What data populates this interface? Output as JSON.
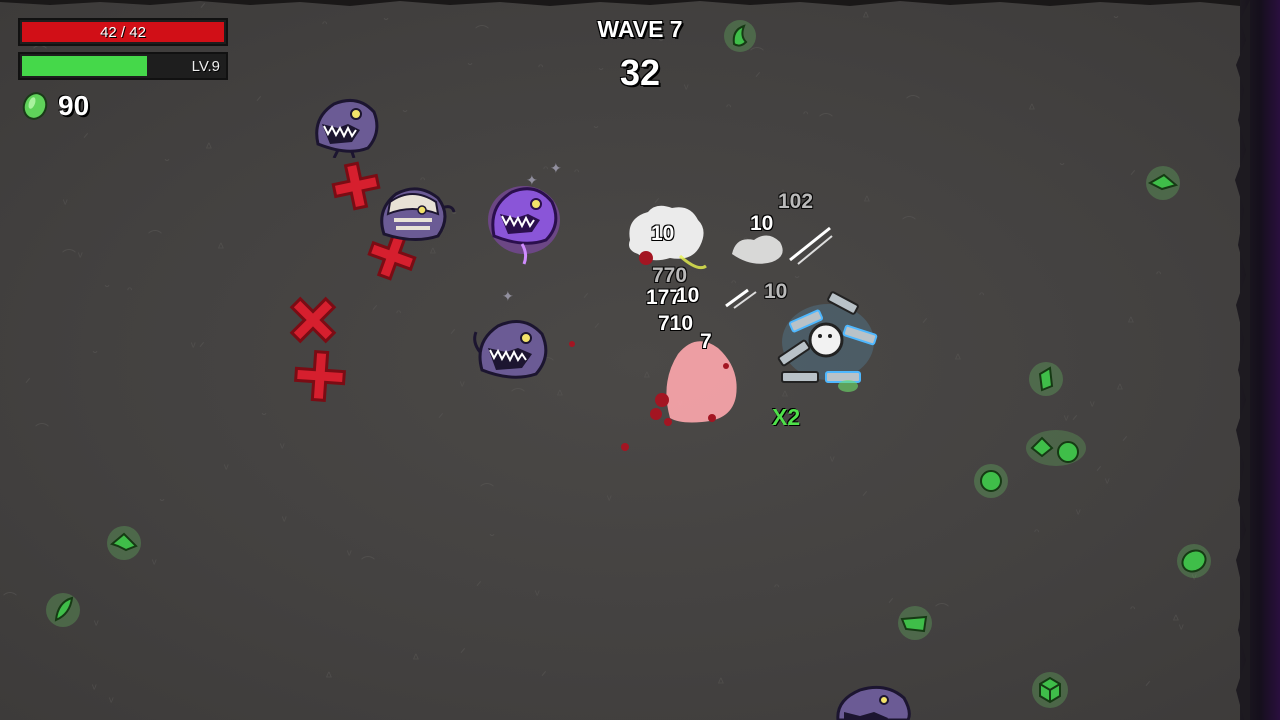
{
  "hud": {
    "hp": {
      "current": 42,
      "max": 42,
      "label": "42 / 42",
      "fraction": 1.0,
      "color": "#d10f17"
    },
    "xp": {
      "level_label": "LV.9",
      "fraction": 0.62,
      "color": "#45d84a"
    },
    "materials": {
      "count": "90",
      "icon": "material-icon"
    }
  },
  "wave": {
    "title": "WAVE 7",
    "timer": "32"
  },
  "damage_numbers": [
    "10",
    "102",
    "10",
    "770",
    "177",
    "10",
    "710",
    "7",
    "10"
  ],
  "combo_label": "X2",
  "colors": {
    "ground": "#454341",
    "material": "#3fbe49",
    "enemy": "#6b5b95",
    "consumable": "#d61f2e",
    "arena_edge": "#2a0f3e"
  },
  "entities": {
    "enemies": [
      "alien-enemy",
      "alien-enemy-elite",
      "alien-enemy",
      "alien-enemy",
      "mummy-alien-enemy"
    ],
    "consumables": [
      "health-cross",
      "health-cross",
      "health-cross",
      "health-cross"
    ],
    "player": "player-with-guns"
  }
}
